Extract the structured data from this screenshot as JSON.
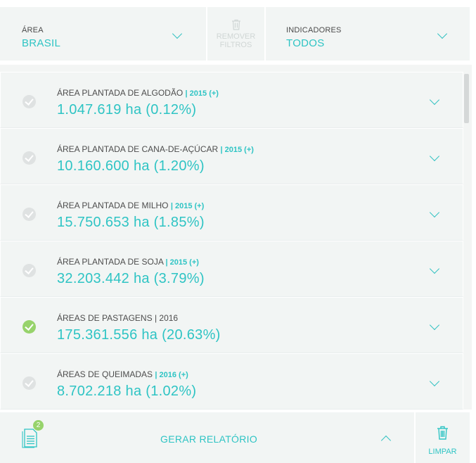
{
  "filters": {
    "area": {
      "label": "ÁREA",
      "value": "BRASIL",
      "icon": "chevron-down-icon"
    },
    "remove": {
      "label_line1": "REMOVER",
      "label_line2": "FILTROS",
      "icon": "trash-icon"
    },
    "indicators": {
      "label": "INDICADORES",
      "value": "TODOS",
      "icon": "chevron-down-icon"
    }
  },
  "indicators": [
    {
      "title": "ÁREA PLANTADA DE ALGODÃO",
      "year": "| 2015 (+)",
      "value": "1.047.619 ha (0.12%)",
      "selected": false,
      "year_highlighted": true
    },
    {
      "title": "ÁREA PLANTADA DE CANA-DE-AÇÚCAR",
      "year": "| 2015 (+)",
      "value": "10.160.600 ha (1.20%)",
      "selected": false,
      "year_highlighted": true
    },
    {
      "title": "ÁREA PLANTADA DE MILHO",
      "year": "| 2015 (+)",
      "value": "15.750.653 ha (1.85%)",
      "selected": false,
      "year_highlighted": true
    },
    {
      "title": "ÁREA PLANTADA DE SOJA",
      "year": "| 2015 (+)",
      "value": "32.203.442 ha (3.79%)",
      "selected": false,
      "year_highlighted": true
    },
    {
      "title": "ÁREAS DE PASTAGENS",
      "year": "| 2016",
      "value": "175.361.556 ha (20.63%)",
      "selected": true,
      "year_highlighted": false
    },
    {
      "title": "ÁREAS DE QUEIMADAS",
      "year": "| 2016 (+)",
      "value": "8.702.218 ha (1.02%)",
      "selected": false,
      "year_highlighted": true
    }
  ],
  "footer": {
    "report": {
      "label": "GERAR RELATÓRIO",
      "badge_count": "2",
      "icon": "report-document-icon"
    },
    "clear": {
      "label": "LIMPAR",
      "icon": "trash-icon"
    }
  },
  "colors": {
    "accent": "#2ec4c4",
    "selected_check": "#97d36b",
    "unselected_check": "#dfe2e2",
    "panel_bg": "#f2f5f4"
  }
}
